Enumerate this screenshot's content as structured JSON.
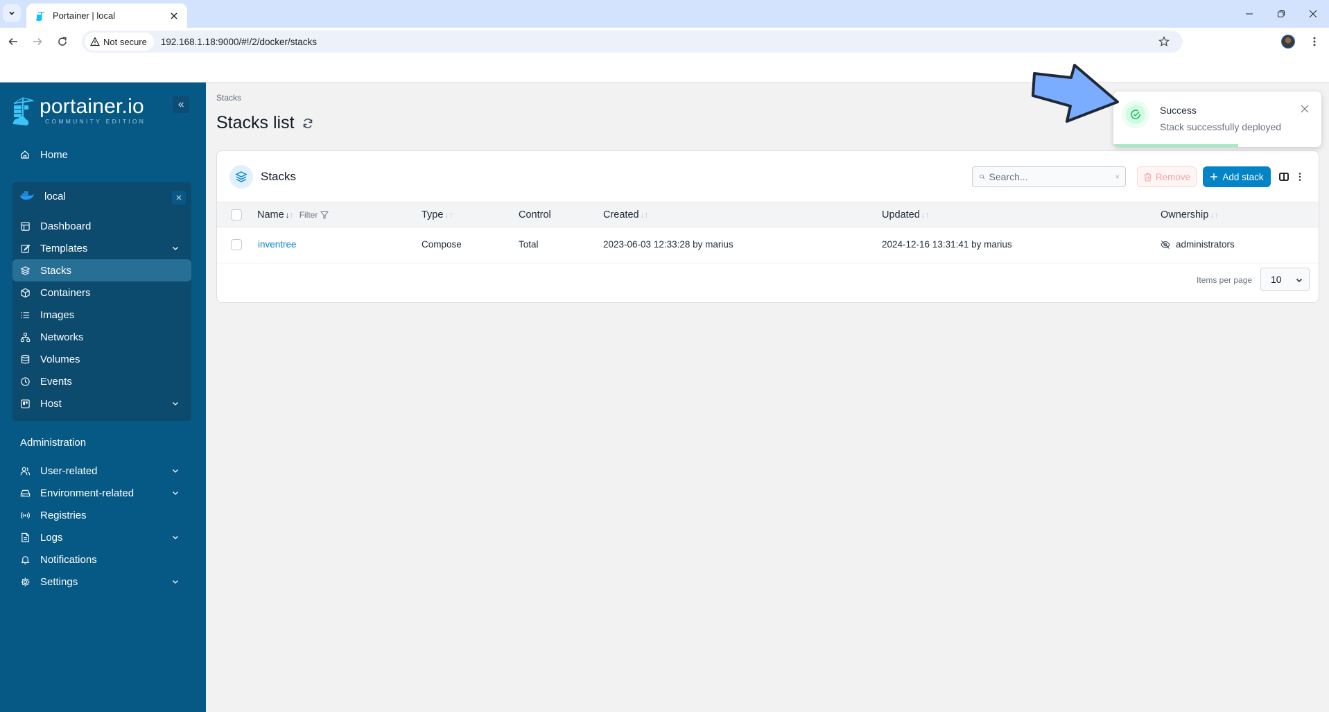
{
  "browser": {
    "tab_title": "Portainer | local",
    "security_label": "Not secure",
    "url": "192.168.1.18:9000/#!/2/docker/stacks"
  },
  "sidebar": {
    "logo_main": "portainer.io",
    "logo_sub": "COMMUNITY EDITION",
    "home_label": "Home",
    "environment": {
      "name": "local",
      "items": [
        {
          "label": "Dashboard",
          "icon": "dashboard-icon",
          "expandable": false,
          "active": false
        },
        {
          "label": "Templates",
          "icon": "templates-icon",
          "expandable": true,
          "active": false
        },
        {
          "label": "Stacks",
          "icon": "stacks-icon",
          "expandable": false,
          "active": true
        },
        {
          "label": "Containers",
          "icon": "containers-icon",
          "expandable": false,
          "active": false
        },
        {
          "label": "Images",
          "icon": "images-icon",
          "expandable": false,
          "active": false
        },
        {
          "label": "Networks",
          "icon": "networks-icon",
          "expandable": false,
          "active": false
        },
        {
          "label": "Volumes",
          "icon": "volumes-icon",
          "expandable": false,
          "active": false
        },
        {
          "label": "Events",
          "icon": "events-icon",
          "expandable": false,
          "active": false
        },
        {
          "label": "Host",
          "icon": "host-icon",
          "expandable": true,
          "active": false
        }
      ]
    },
    "admin_heading": "Administration",
    "admin_items": [
      {
        "label": "User-related",
        "icon": "users-icon",
        "expandable": true
      },
      {
        "label": "Environment-related",
        "icon": "environment-icon",
        "expandable": true
      },
      {
        "label": "Registries",
        "icon": "registries-icon",
        "expandable": false
      },
      {
        "label": "Logs",
        "icon": "logs-icon",
        "expandable": true
      },
      {
        "label": "Notifications",
        "icon": "bell-icon",
        "expandable": false
      },
      {
        "label": "Settings",
        "icon": "gear-icon",
        "expandable": true
      }
    ]
  },
  "main": {
    "breadcrumb": "Stacks",
    "page_title": "Stacks list",
    "card": {
      "title": "Stacks",
      "search_placeholder": "Search...",
      "search_value": "",
      "remove_label": "Remove",
      "add_label": "Add stack",
      "columns": [
        "Name",
        "Type",
        "Control",
        "Created",
        "Updated",
        "Ownership"
      ],
      "filter_label": "Filter",
      "rows": [
        {
          "name": "inventree",
          "type": "Compose",
          "control": "Total",
          "created": "2023-06-03 12:33:28 by marius",
          "updated": "2024-12-16 13:31:41 by marius",
          "ownership": "administrators"
        }
      ],
      "items_per_page_label": "Items per page",
      "items_per_page": "10"
    }
  },
  "toast": {
    "title": "Success",
    "message": "Stack successfully deployed",
    "progress_fraction": 0.6
  },
  "colors": {
    "sidebar_bg": "#075985",
    "accent": "#0284c7",
    "success": "#12b76a"
  }
}
